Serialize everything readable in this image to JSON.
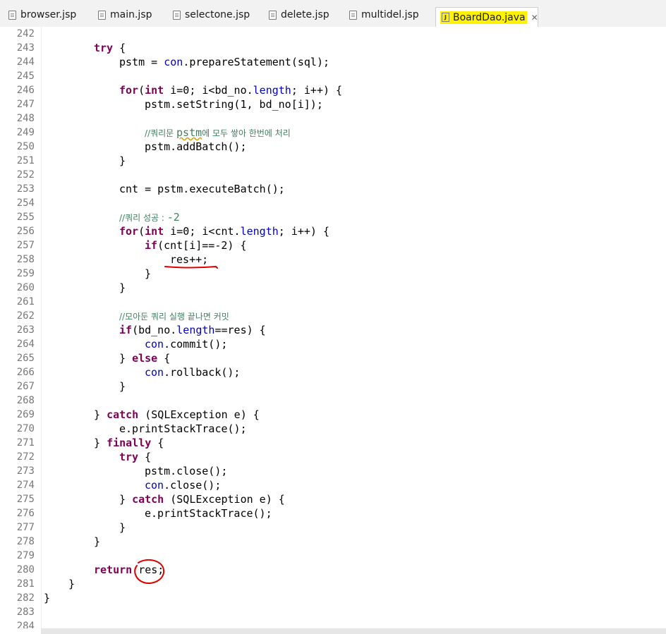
{
  "tabs": [
    {
      "label": "browser.jsp",
      "active": false
    },
    {
      "label": "main.jsp",
      "active": false
    },
    {
      "label": "selectone.jsp",
      "active": false
    },
    {
      "label": "delete.jsp",
      "active": false
    },
    {
      "label": "multidel.jsp",
      "active": false
    },
    {
      "label": "BoardDao.java",
      "active": true
    }
  ],
  "active_tab_icon": "java-file-icon",
  "close_icon": "close-icon",
  "highlight_color": "#fff200",
  "annotation_color": "#e00000",
  "line_numbers": [
    "242",
    "243",
    "244",
    "245",
    "246",
    "247",
    "248",
    "249",
    "250",
    "251",
    "252",
    "253",
    "254",
    "255",
    "256",
    "257",
    "258",
    "259",
    "260",
    "261",
    "262",
    "263",
    "264",
    "265",
    "266",
    "267",
    "268",
    "269",
    "270",
    "271",
    "272",
    "273",
    "274",
    "275",
    "276",
    "277",
    "278",
    "279",
    "280",
    "281",
    "282",
    "283",
    "284"
  ],
  "code": {
    "l243_kw": "try",
    "l243_rest": " {",
    "l244_a": "pstm = ",
    "l244_fld": "con",
    "l244_b": ".prepareStatement(sql);",
    "l246_kw1": "for",
    "l246_a": "(",
    "l246_kw2": "int",
    "l246_b": " i=0; i<bd_no.",
    "l246_fld": "length",
    "l246_c": "; i++) {",
    "l247": "pstm.setString(1, bd_no[i]);",
    "l249_a": "//쿼리문 ",
    "l249_b": "pstm",
    "l249_c": "에 모두 쌓아 한번에 처리",
    "l250": "pstm.addBatch();",
    "l251": "}",
    "l253": "cnt = pstm.executeBatch();",
    "l255_a": "//쿼리 성공 : ",
    "l255_b": "-2",
    "l256_kw1": "for",
    "l256_a": "(",
    "l256_kw2": "int",
    "l256_b": " i=0; i<cnt.",
    "l256_fld": "length",
    "l256_c": "; i++) {",
    "l257_kw": "if",
    "l257_rest": "(cnt[i]==-2) {",
    "l258": "res++;",
    "l259": "}",
    "l260": "}",
    "l262": "//모아둔 쿼리 실행 끝나면 커밋",
    "l263_kw": "if",
    "l263_a": "(bd_no.",
    "l263_fld": "length",
    "l263_b": "==res) {",
    "l264_fld": "con",
    "l264_rest": ".commit();",
    "l265_a": "} ",
    "l265_kw": "else",
    "l265_b": " {",
    "l266_fld": "con",
    "l266_rest": ".rollback();",
    "l267": "}",
    "l269_a": "} ",
    "l269_kw": "catch",
    "l269_b": " (SQLException e) {",
    "l270": "e.printStackTrace();",
    "l271_a": "} ",
    "l271_kw": "finally",
    "l271_b": " {",
    "l272_kw": "try",
    "l272_rest": " {",
    "l273": "pstm.close();",
    "l274_fld": "con",
    "l274_rest": ".close();",
    "l275_a": "} ",
    "l275_kw": "catch",
    "l275_b": " (SQLException e) {",
    "l276": "e.printStackTrace();",
    "l277": "}",
    "l278": "}",
    "l280_kw": "return",
    "l280_rest": " res;",
    "l281": "}",
    "l282": "}"
  }
}
